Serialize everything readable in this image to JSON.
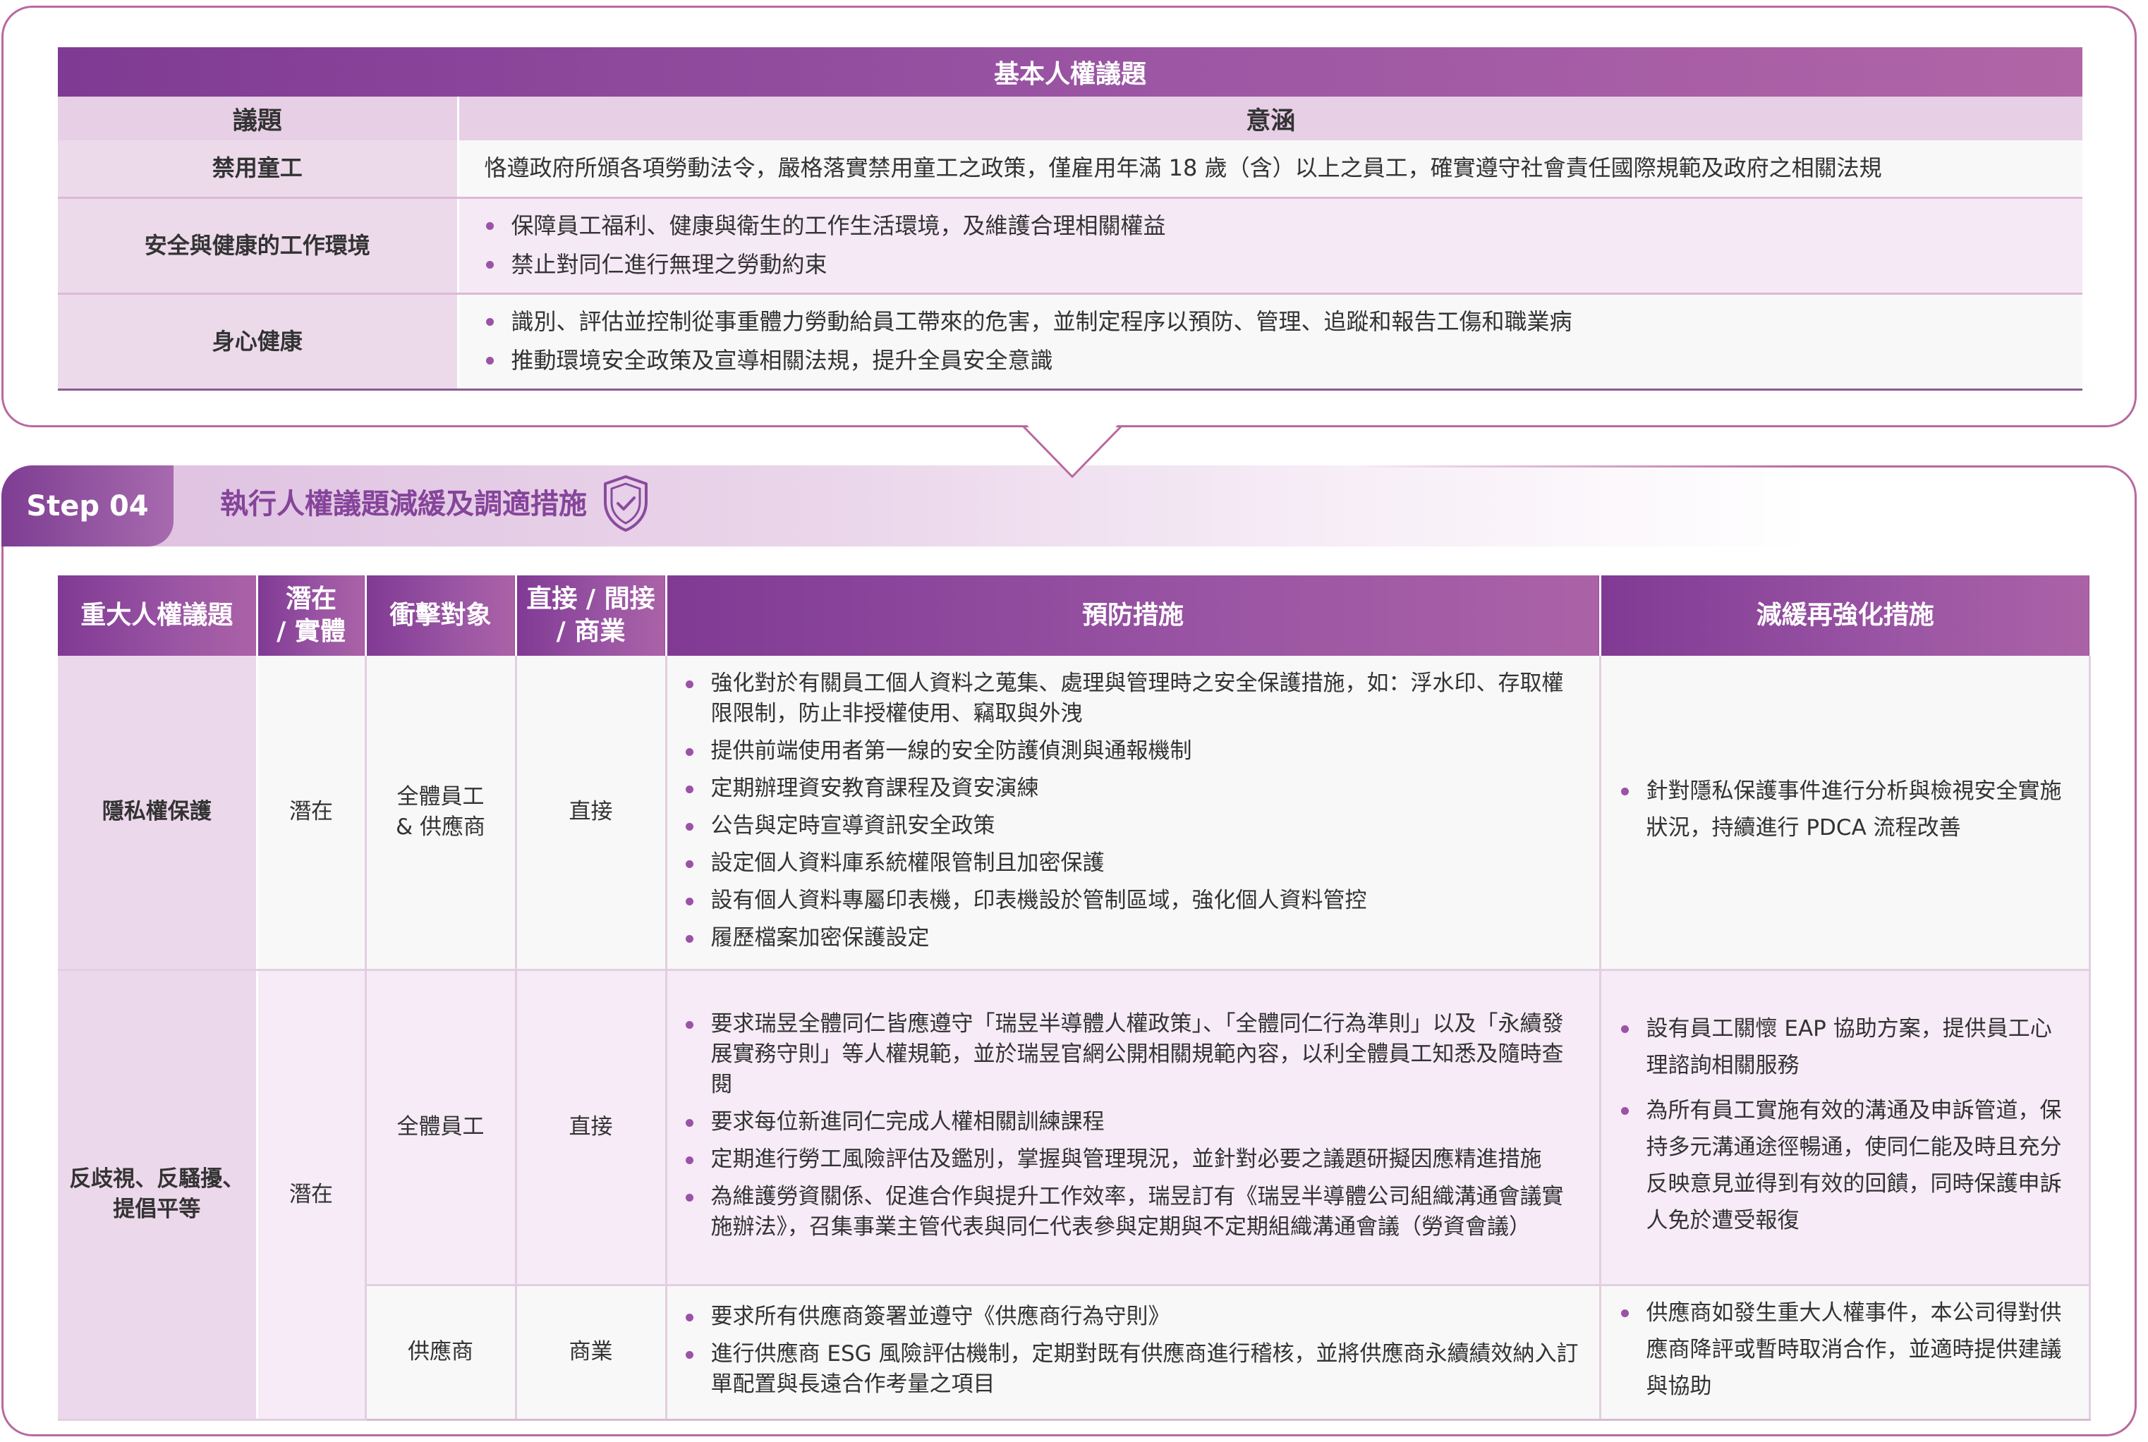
{
  "basic_rights": {
    "title": "基本人權議題",
    "headers": {
      "issue": "議題",
      "meaning": "意涵"
    },
    "rows": [
      {
        "issue": "禁用童工",
        "points": [
          "恪遵政府所頒各項勞動法令，嚴格落實禁用童工之政策，僅雇用年滿 18 歲（含）以上之員工，確實遵守社會責任國際規範及政府之相關法規"
        ]
      },
      {
        "issue": "安全與健康的工作環境",
        "points": [
          "保障員工福利、健康與衛生的工作生活環境，及維護合理相關權益",
          "禁止對同仁進行無理之勞動約束"
        ]
      },
      {
        "issue": "身心健康",
        "points": [
          "識別、評估並控制從事重體力勞動給員工帶來的危害，並制定程序以預防、管理、追蹤和報告工傷和職業病",
          "推動環境安全政策及宣導相關法規，提升全員安全意識"
        ]
      }
    ]
  },
  "step": {
    "label": "Step 04",
    "title": "執行人權議題減緩及調適措施",
    "icon": "shield-check-icon"
  },
  "measures": {
    "headers": {
      "issue": "重大人權議題",
      "potential_line1": "潛在",
      "potential_line2": "/ 實體",
      "target": "衝擊對象",
      "direct_line1": "直接 / 間接",
      "direct_line2": "/ 商業",
      "prevention": "預防措施",
      "mitigation": "減緩再強化措施"
    },
    "privacy": {
      "issue": "隱私權保護",
      "potential": "潛在",
      "target_line1": "全體員工",
      "target_line2": "& 供應商",
      "direct": "直接",
      "prevention": [
        "強化對於有關員工個人資料之蒐集、處理與管理時之安全保護措施，如：浮水印、存取權限限制，防止非授權使用、竊取與外洩",
        "提供前端使用者第一線的安全防護偵測與通報機制",
        "定期辦理資安教育課程及資安演練",
        "公告與定時宣導資訊安全政策",
        "設定個人資料庫系統權限管制且加密保護",
        "設有個人資料專屬印表機，印表機設於管制區域，強化個人資料管控",
        "履歷檔案加密保護設定"
      ],
      "mitigation": [
        "針對隱私保護事件進行分析與檢視安全實施狀況，持續進行 PDCA 流程改善"
      ]
    },
    "discrimination": {
      "issue_line1": "反歧視、反騷擾、",
      "issue_line2": "提倡平等",
      "potential": "潛在",
      "employees": {
        "target": "全體員工",
        "direct": "直接",
        "prevention": [
          "要求瑞昱全體同仁皆應遵守「瑞昱半導體人權政策」、「全體同仁行為準則」以及「永續發展實務守則」等人權規範，並於瑞昱官網公開相關規範內容，以利全體員工知悉及隨時查閱",
          "要求每位新進同仁完成人權相關訓練課程",
          "定期進行勞工風險評估及鑑別，掌握與管理現況，並針對必要之議題研擬因應精進措施",
          "為維護勞資關係、促進合作與提升工作效率，瑞昱訂有《瑞昱半導體公司組織溝通會議實施辦法》，召集事業主管代表與同仁代表參與定期與不定期組織溝通會議（勞資會議）"
        ],
        "mitigation": [
          "設有員工關懷 EAP 協助方案，提供員工心理諮詢相關服務",
          "為所有員工實施有效的溝通及申訴管道，保持多元溝通途徑暢通，使同仁能及時且充分反映意見並得到有效的回饋，同時保護申訴人免於遭受報復"
        ]
      },
      "suppliers": {
        "target": "供應商",
        "direct": "商業",
        "prevention": [
          "要求所有供應商簽署並遵守《供應商行為守則》",
          "進行供應商 ESG 風險評估機制，定期對既有供應商進行稽核，並將供應商永續績效納入訂單配置與長遠合作考量之項目"
        ],
        "mitigation": [
          "供應商如發生重大人權事件，本公司得對供應商降評或暫時取消合作，並適時提供建議與協助"
        ]
      }
    }
  }
}
